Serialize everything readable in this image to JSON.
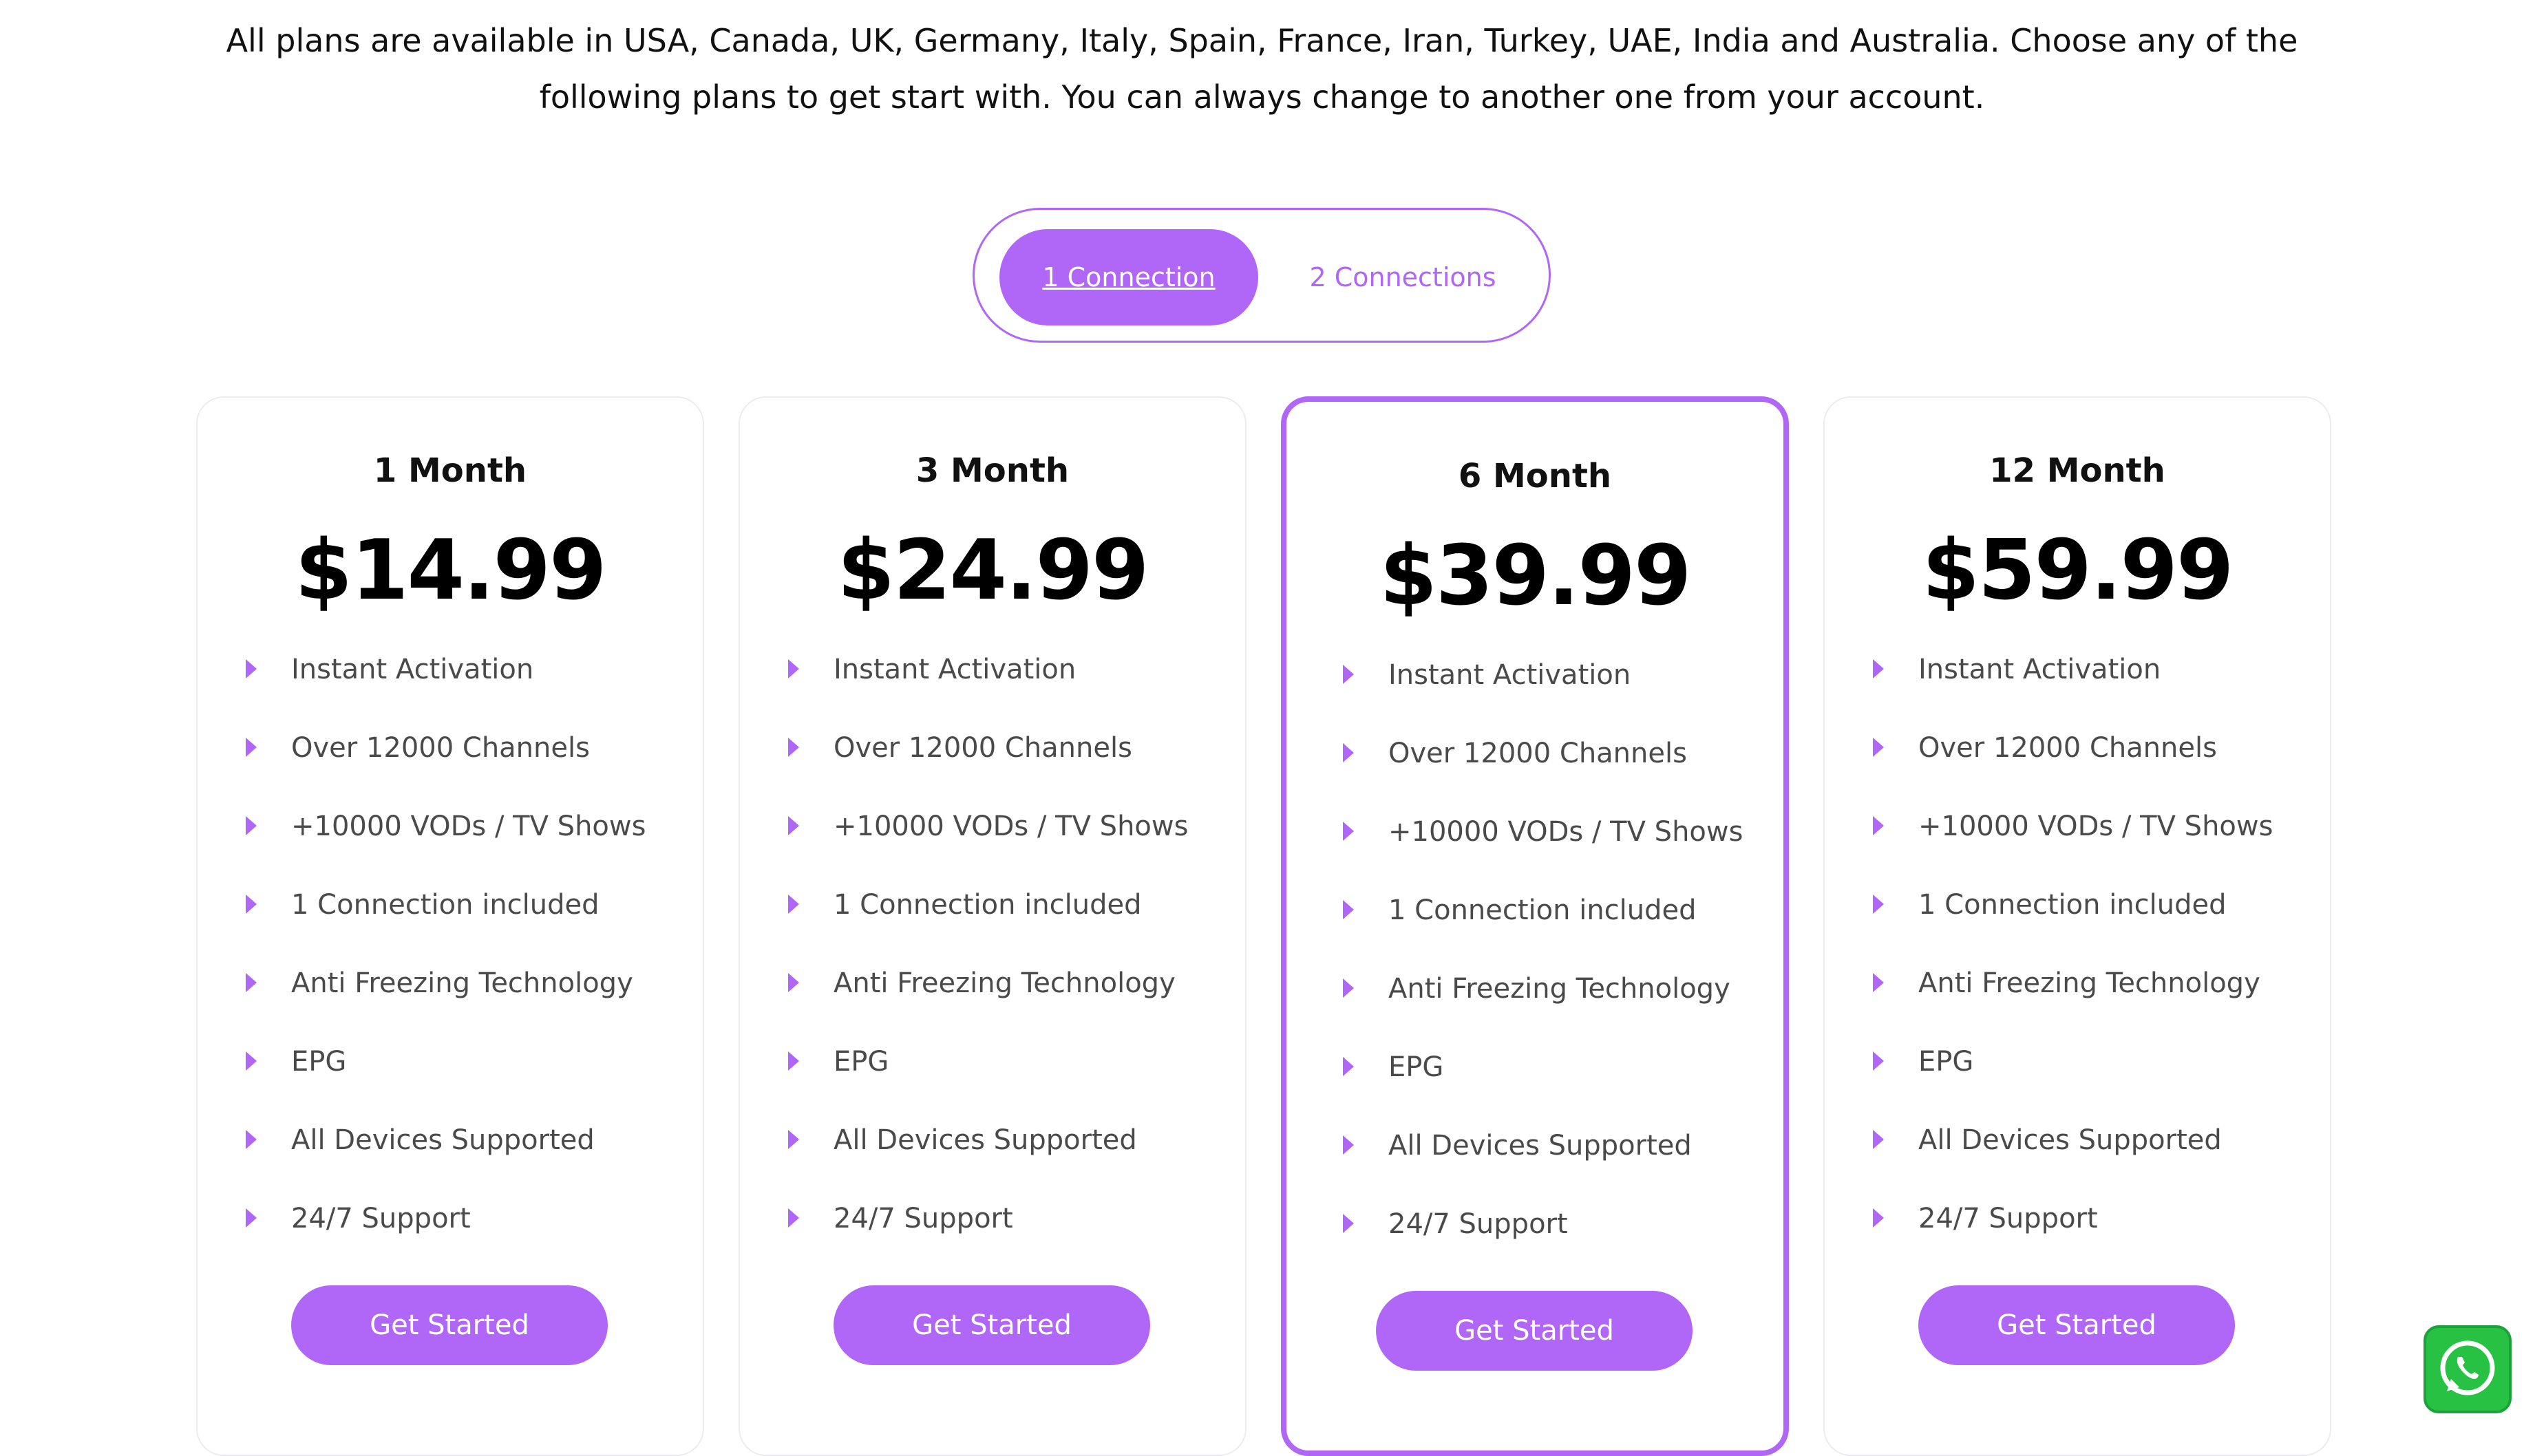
{
  "intro": {
    "line1": "All plans are available in USA, Canada, UK, Germany, Italy, Spain, France, Iran, Turkey, UAE, India and Australia. Choose any of the",
    "line2": "following plans to get start with. You can always change to another one from your account."
  },
  "toggle": {
    "active_label": "1 Connection",
    "inactive_label": "2 Connections"
  },
  "colors": {
    "accent": "#b066f6",
    "feature_text": "#4a4a4a",
    "whatsapp_green": "#27c244"
  },
  "plans": [
    {
      "name": "1 Month",
      "price": "$14.99",
      "featured": false,
      "features": [
        "Instant Activation",
        "Over 12000 Channels",
        "+10000 VODs / TV Shows",
        "1 Connection included",
        "Anti Freezing Technology",
        "EPG",
        "All Devices Supported",
        "24/7 Support"
      ],
      "cta": "Get Started"
    },
    {
      "name": "3 Month",
      "price": "$24.99",
      "featured": false,
      "features": [
        "Instant Activation",
        "Over 12000 Channels",
        "+10000 VODs / TV Shows",
        "1 Connection included",
        "Anti Freezing Technology",
        "EPG",
        "All Devices Supported",
        "24/7 Support"
      ],
      "cta": "Get Started"
    },
    {
      "name": "6 Month",
      "price": "$39.99",
      "featured": true,
      "features": [
        "Instant Activation",
        "Over 12000 Channels",
        "+10000 VODs / TV Shows",
        "1 Connection included",
        "Anti Freezing Technology",
        "EPG",
        "All Devices Supported",
        "24/7 Support"
      ],
      "cta": "Get Started"
    },
    {
      "name": "12 Month",
      "price": "$59.99",
      "featured": false,
      "features": [
        "Instant Activation",
        "Over 12000 Channels",
        "+10000 VODs / TV Shows",
        "1 Connection included",
        "Anti Freezing Technology",
        "EPG",
        "All Devices Supported",
        "24/7 Support"
      ],
      "cta": "Get Started"
    }
  ],
  "floating": {
    "icon": "whatsapp-icon"
  }
}
